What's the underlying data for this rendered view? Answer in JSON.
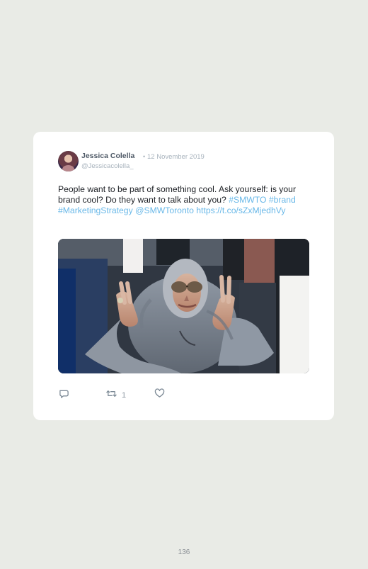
{
  "tweet": {
    "author_name": "Jessica Colella",
    "separator": "•",
    "date": "12 November 2019",
    "handle": "@Jessicacolella_",
    "text_parts": [
      "People want to be part of something cool. Ask yourself: is your brand cool? Do they want to talk about you? ",
      "#SMWTO",
      " ",
      "#brand",
      " ",
      "#MarketingStrategy",
      " ",
      "@SMWToronto",
      " ",
      "https://t.co/sZxMjedhVy"
    ],
    "retweet_count": "1"
  },
  "icons": {
    "reply": "reply-icon",
    "retweet": "retweet-icon",
    "like": "heart-icon",
    "media": "embedded-animated-image"
  },
  "colors": {
    "background": "#e9ebe6",
    "card": "#ffffff",
    "link": "#69b8e8",
    "muted": "#a8b3bd",
    "name": "#4f5a67"
  },
  "footer": {
    "page_number": "136"
  }
}
